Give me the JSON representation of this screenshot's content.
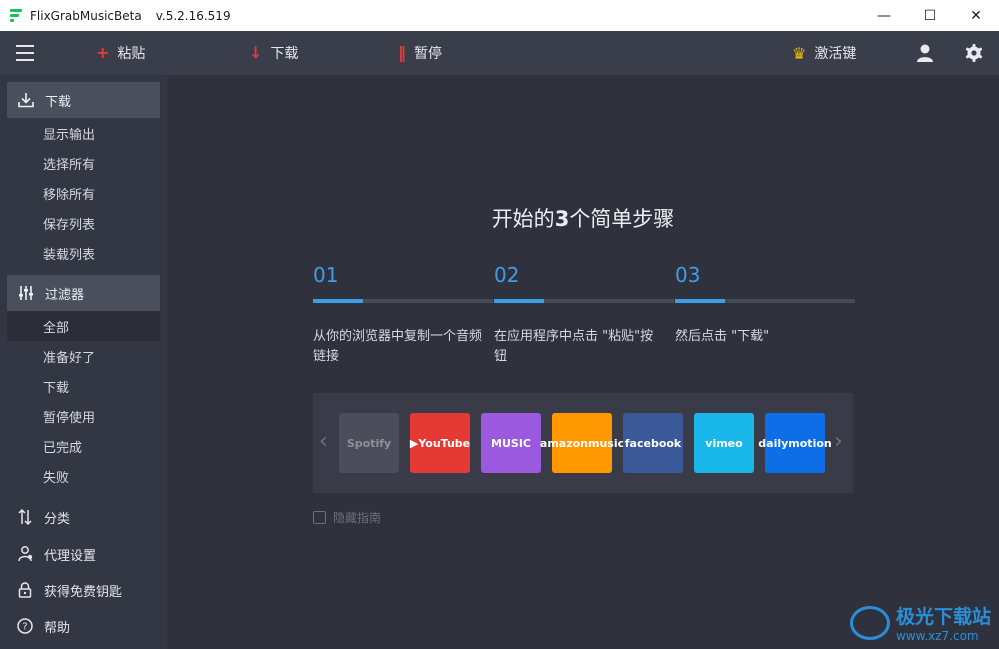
{
  "window": {
    "app_name": "FlixGrabMusicBeta",
    "version": "v.5.2.16.519",
    "minimize": "—",
    "maximize": "☐",
    "close": "✕"
  },
  "toolbar": {
    "paste_label": "粘贴",
    "download_label": "下载",
    "pause_label": "暂停",
    "activate_label": "激活键"
  },
  "sidebar": {
    "download_header": "下载",
    "download_items": [
      "显示输出",
      "选择所有",
      "移除所有",
      "保存列表",
      "装载列表"
    ],
    "filter_header": "过滤器",
    "filter_items": [
      "全部",
      "准备好了",
      "下载",
      "暂停使用",
      "已完成",
      "失败"
    ],
    "filter_active": "全部",
    "bottom_items": [
      "分类",
      "代理设置",
      "获得免费钥匙",
      "帮助"
    ]
  },
  "main": {
    "title_part1": "开始的",
    "title_num": "3",
    "title_part2": "个简单步骤",
    "steps": [
      {
        "num": "01",
        "text": "从你的浏览器中复制一个音频链接"
      },
      {
        "num": "02",
        "text": "在应用程序中点击 \"粘贴\"按钮"
      },
      {
        "num": "03",
        "text": "然后点击 \"下载\""
      }
    ],
    "services": [
      {
        "label": "Spotify",
        "color": "#4b4e5a",
        "text_color": "#8d909a"
      },
      {
        "label": "▶YouTube",
        "color": "#e53935",
        "text_color": "#ffffff"
      },
      {
        "label": "MUSIC",
        "color": "#9b59e0",
        "text_color": "#ffffff"
      },
      {
        "label": "amazonmusic",
        "color": "#ff9800",
        "text_color": "#ffffff"
      },
      {
        "label": "facebook",
        "color": "#3b5998",
        "text_color": "#ffffff"
      },
      {
        "label": "vimeo",
        "color": "#1ab7ea",
        "text_color": "#ffffff"
      },
      {
        "label": "dailymotion",
        "color": "#0d6ee8",
        "text_color": "#ffffff"
      }
    ],
    "prev_arrow": "‹",
    "next_arrow": "›",
    "hide_guide": "隐藏指南"
  },
  "watermark": {
    "title": "极光下载站",
    "url": "www.xz7.com"
  },
  "colors": {
    "accent": "#3d9ee8",
    "red_icon": "#e5393b",
    "crown": "#f2b705"
  }
}
